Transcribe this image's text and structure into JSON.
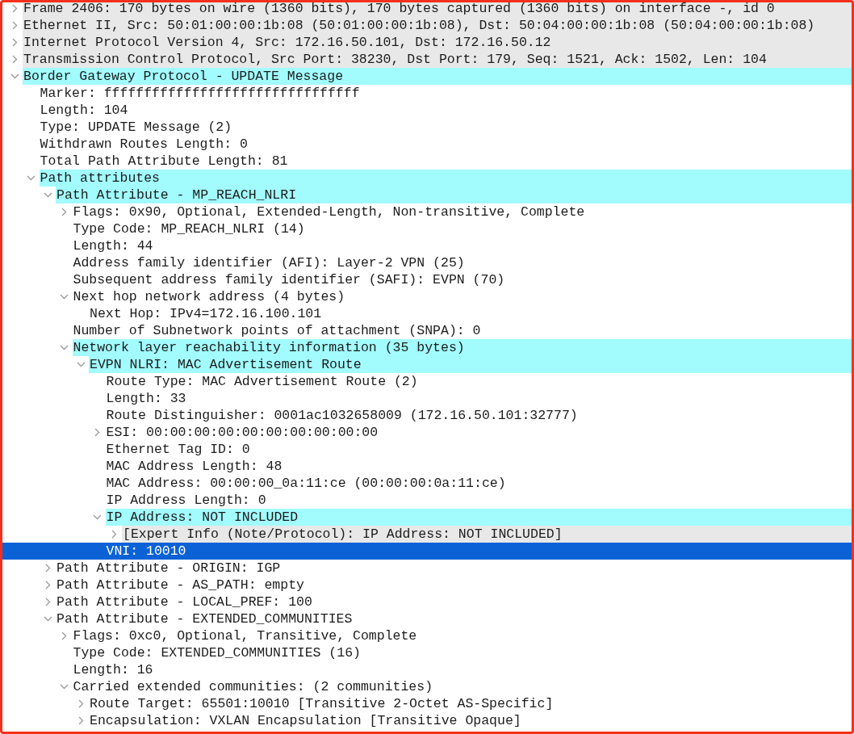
{
  "tree": [
    {
      "label": "Frame 2406: 170 bytes on wire (1360 bits), 170 bytes captured (1360 bits) on interface -, id 0",
      "highlighted": false,
      "shaded": true,
      "expanded": false,
      "selected": false
    },
    {
      "label": "Ethernet II, Src: 50:01:00:00:1b:08 (50:01:00:00:1b:08), Dst: 50:04:00:00:1b:08 (50:04:00:00:1b:08)",
      "highlighted": false,
      "shaded": true,
      "expanded": false,
      "selected": false
    },
    {
      "label": "Internet Protocol Version 4, Src: 172.16.50.101, Dst: 172.16.50.12",
      "highlighted": false,
      "shaded": true,
      "expanded": false,
      "selected": false
    },
    {
      "label": "Transmission Control Protocol, Src Port: 38230, Dst Port: 179, Seq: 1521, Ack: 1502, Len: 104",
      "highlighted": false,
      "shaded": true,
      "expanded": false,
      "selected": false
    },
    {
      "label": "Border Gateway Protocol - UPDATE Message",
      "highlighted": true,
      "shaded": false,
      "expanded": true,
      "selected": false,
      "children": [
        {
          "label": "Marker: ffffffffffffffffffffffffffffffff",
          "highlighted": false,
          "shaded": false,
          "selected": false
        },
        {
          "label": "Length: 104",
          "highlighted": false,
          "shaded": false,
          "selected": false
        },
        {
          "label": "Type: UPDATE Message (2)",
          "highlighted": false,
          "shaded": false,
          "selected": false
        },
        {
          "label": "Withdrawn Routes Length: 0",
          "highlighted": false,
          "shaded": false,
          "selected": false
        },
        {
          "label": "Total Path Attribute Length: 81",
          "highlighted": false,
          "shaded": false,
          "selected": false
        },
        {
          "label": "Path attributes",
          "highlighted": true,
          "shaded": false,
          "expanded": true,
          "selected": false,
          "children": [
            {
              "label": "Path Attribute - MP_REACH_NLRI",
              "highlighted": true,
              "shaded": false,
              "expanded": true,
              "selected": false,
              "children": [
                {
                  "label": "Flags: 0x90, Optional, Extended-Length, Non-transitive, Complete",
                  "highlighted": false,
                  "shaded": false,
                  "expanded": false,
                  "selected": false
                },
                {
                  "label": "Type Code: MP_REACH_NLRI (14)",
                  "highlighted": false,
                  "shaded": false,
                  "selected": false
                },
                {
                  "label": "Length: 44",
                  "highlighted": false,
                  "shaded": false,
                  "selected": false
                },
                {
                  "label": "Address family identifier (AFI): Layer-2 VPN (25)",
                  "highlighted": false,
                  "shaded": false,
                  "selected": false
                },
                {
                  "label": "Subsequent address family identifier (SAFI): EVPN (70)",
                  "highlighted": false,
                  "shaded": false,
                  "selected": false
                },
                {
                  "label": "Next hop network address (4 bytes)",
                  "highlighted": false,
                  "shaded": false,
                  "expanded": true,
                  "selected": false,
                  "children": [
                    {
                      "label": "Next Hop: IPv4=172.16.100.101",
                      "highlighted": false,
                      "shaded": false,
                      "selected": false
                    }
                  ]
                },
                {
                  "label": "Number of Subnetwork points of attachment (SNPA): 0",
                  "highlighted": false,
                  "shaded": false,
                  "selected": false
                },
                {
                  "label": "Network layer reachability information (35 bytes)",
                  "highlighted": true,
                  "shaded": false,
                  "expanded": true,
                  "selected": false,
                  "children": [
                    {
                      "label": "EVPN NLRI: MAC Advertisement Route",
                      "highlighted": true,
                      "shaded": false,
                      "expanded": true,
                      "selected": false,
                      "children": [
                        {
                          "label": "Route Type: MAC Advertisement Route (2)",
                          "highlighted": false,
                          "shaded": false,
                          "selected": false
                        },
                        {
                          "label": "Length: 33",
                          "highlighted": false,
                          "shaded": false,
                          "selected": false
                        },
                        {
                          "label": "Route Distinguisher: 0001ac1032658009 (172.16.50.101:32777)",
                          "highlighted": false,
                          "shaded": false,
                          "selected": false
                        },
                        {
                          "label": "ESI: 00:00:00:00:00:00:00:00:00:00",
                          "highlighted": false,
                          "shaded": false,
                          "expanded": false,
                          "selected": false
                        },
                        {
                          "label": "Ethernet Tag ID: 0",
                          "highlighted": false,
                          "shaded": false,
                          "selected": false
                        },
                        {
                          "label": "MAC Address Length: 48",
                          "highlighted": false,
                          "shaded": false,
                          "selected": false
                        },
                        {
                          "label": "MAC Address: 00:00:00_0a:11:ce (00:00:00:0a:11:ce)",
                          "highlighted": false,
                          "shaded": false,
                          "selected": false
                        },
                        {
                          "label": "IP Address Length: 0",
                          "highlighted": false,
                          "shaded": false,
                          "selected": false
                        },
                        {
                          "label": "IP Address: NOT INCLUDED",
                          "highlighted": true,
                          "shaded": false,
                          "expanded": true,
                          "selected": false,
                          "children": [
                            {
                              "label": "[Expert Info (Note/Protocol): IP Address: NOT INCLUDED]",
                              "highlighted": false,
                              "shaded": true,
                              "expanded": false,
                              "selected": false
                            }
                          ]
                        },
                        {
                          "label": "VNI: 10010",
                          "highlighted": false,
                          "shaded": false,
                          "selected": true
                        }
                      ]
                    }
                  ]
                }
              ]
            },
            {
              "label": "Path Attribute - ORIGIN: IGP",
              "highlighted": false,
              "shaded": false,
              "expanded": false,
              "selected": false
            },
            {
              "label": "Path Attribute - AS_PATH: empty",
              "highlighted": false,
              "shaded": false,
              "expanded": false,
              "selected": false
            },
            {
              "label": "Path Attribute - LOCAL_PREF: 100",
              "highlighted": false,
              "shaded": false,
              "expanded": false,
              "selected": false
            },
            {
              "label": "Path Attribute - EXTENDED_COMMUNITIES",
              "highlighted": false,
              "shaded": false,
              "expanded": true,
              "selected": false,
              "children": [
                {
                  "label": "Flags: 0xc0, Optional, Transitive, Complete",
                  "highlighted": false,
                  "shaded": false,
                  "expanded": false,
                  "selected": false
                },
                {
                  "label": "Type Code: EXTENDED_COMMUNITIES (16)",
                  "highlighted": false,
                  "shaded": false,
                  "selected": false
                },
                {
                  "label": "Length: 16",
                  "highlighted": false,
                  "shaded": false,
                  "selected": false
                },
                {
                  "label": "Carried extended communities: (2 communities)",
                  "highlighted": false,
                  "shaded": false,
                  "expanded": true,
                  "selected": false,
                  "children": [
                    {
                      "label": "Route Target: 65501:10010 [Transitive 2-Octet AS-Specific]",
                      "highlighted": false,
                      "shaded": false,
                      "expanded": false,
                      "selected": false
                    },
                    {
                      "label": "Encapsulation: VXLAN Encapsulation [Transitive Opaque]",
                      "highlighted": false,
                      "shaded": false,
                      "expanded": false,
                      "selected": false
                    }
                  ]
                }
              ]
            }
          ]
        }
      ]
    }
  ]
}
